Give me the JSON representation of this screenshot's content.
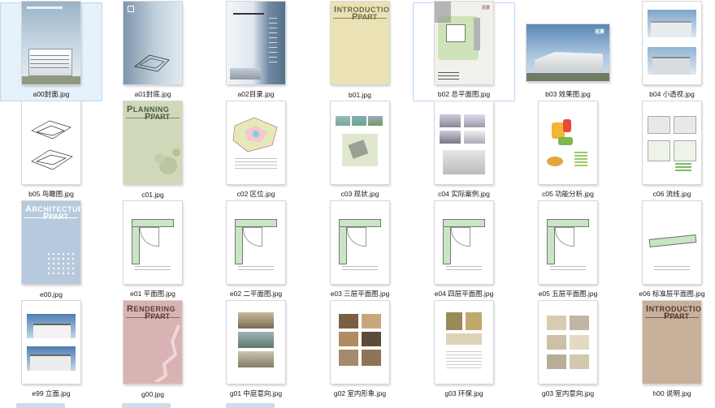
{
  "files": [
    {
      "name": "a00封面.jpg",
      "selected": true,
      "art": "cover-city"
    },
    {
      "name": "a01封底.jpg",
      "art": "cover-map"
    },
    {
      "name": "a02目录.jpg",
      "art": "toc"
    },
    {
      "name": "b01.jpg",
      "art": "intro-yellow",
      "title": "NTRODUCTION",
      "title2": "PART",
      "initial1": "I",
      "initial2": "P"
    },
    {
      "name": "b02 总平面图.jpg",
      "hover": true,
      "art": "siteplan",
      "brand": "冠景"
    },
    {
      "name": "b03 效果图.jpg",
      "art": "render-landscape",
      "brand": "冠景"
    },
    {
      "name": "b04 小透视.jpg",
      "art": "two-photos"
    },
    {
      "name": "b05 鸟瞰图.jpg",
      "art": "sketch"
    },
    {
      "name": "c01.jpg",
      "art": "planning-green",
      "title": "LANNING",
      "title2": "PART",
      "initial1": "P",
      "initial2": "P"
    },
    {
      "name": "c02 区位.jpg",
      "art": "location"
    },
    {
      "name": "c03 现状.jpg",
      "art": "status"
    },
    {
      "name": "c04 实际案例.jpg",
      "art": "cases"
    },
    {
      "name": "c05 功能分析.jpg",
      "art": "function"
    },
    {
      "name": "c06 流线.jpg",
      "art": "flow"
    },
    {
      "name": "e00.jpg",
      "art": "arch-blue",
      "title": "RCHITECTURE",
      "title2": "PART",
      "initial1": "A",
      "initial2": "P"
    },
    {
      "name": "e01 平面图.jpg",
      "art": "floorplan"
    },
    {
      "name": "e02 二平面图.jpg",
      "art": "floorplan"
    },
    {
      "name": "e03 三层平面图.jpg",
      "art": "floorplan"
    },
    {
      "name": "e04 四层平面图.jpg",
      "art": "floorplan"
    },
    {
      "name": "e05 五层平面图.jpg",
      "art": "floorplan2"
    },
    {
      "name": "e06 标准层平面图.jpg",
      "art": "floorplan3"
    },
    {
      "name": "e99 立面.jpg",
      "art": "elevation"
    },
    {
      "name": "g00.jpg",
      "art": "rendering-pink",
      "title": "ENDERING",
      "title2": "PART",
      "initial1": "R",
      "initial2": "P"
    },
    {
      "name": "g01 中庭意向.jpg",
      "art": "photos3"
    },
    {
      "name": "g02 室内形象.jpg",
      "art": "photos-grid"
    },
    {
      "name": "g03 环保.jpg",
      "art": "photos2text"
    },
    {
      "name": "g03 室内意向.jpg",
      "art": "photos-interior"
    },
    {
      "name": "h00 说明.jpg",
      "art": "intro-brown",
      "title": "NTRODUCTION",
      "title2": "PART",
      "initial1": "I",
      "initial2": "P"
    }
  ],
  "colors": {
    "selection_bg": "#e5f1fb",
    "selection_border": "#b8d6f3"
  }
}
